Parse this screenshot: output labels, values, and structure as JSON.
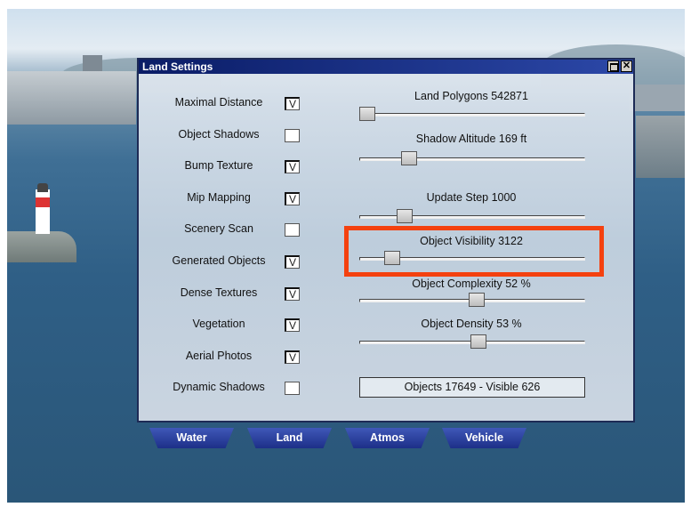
{
  "window": {
    "title": "Land Settings"
  },
  "options": [
    {
      "label": "Maximal Distance",
      "checked": true
    },
    {
      "label": "Object Shadows",
      "checked": false
    },
    {
      "label": "Bump Texture",
      "checked": true
    },
    {
      "label": "Mip Mapping",
      "checked": true
    },
    {
      "label": "Scenery Scan",
      "checked": false
    },
    {
      "label": "Generated Objects",
      "checked": true
    },
    {
      "label": "Dense Textures",
      "checked": true
    },
    {
      "label": "Vegetation",
      "checked": true
    },
    {
      "label": "Aerial Photos",
      "checked": true
    },
    {
      "label": "Dynamic Shadows",
      "checked": false
    }
  ],
  "checkmark": "V",
  "sliders": [
    {
      "label": "Land Polygons 542871",
      "level": 0.0
    },
    {
      "label": "Shadow Altitude 169 ft",
      "level": 0.2
    },
    {
      "label": "Update Step 1000",
      "level": 0.18
    },
    {
      "label": "Object Visibility 3122",
      "level": 0.12
    },
    {
      "label": "Object Complexity 52 %",
      "level": 0.52
    },
    {
      "label": "Object Density 53 %",
      "level": 0.53
    }
  ],
  "status": "Objects 17649 - Visible 626",
  "tabs": [
    "Water",
    "Land",
    "Atmos",
    "Vehicle"
  ],
  "colors": {
    "highlight": "#f4410f",
    "titlebar": "#0a1c66",
    "tab": "#2a3f9e"
  }
}
